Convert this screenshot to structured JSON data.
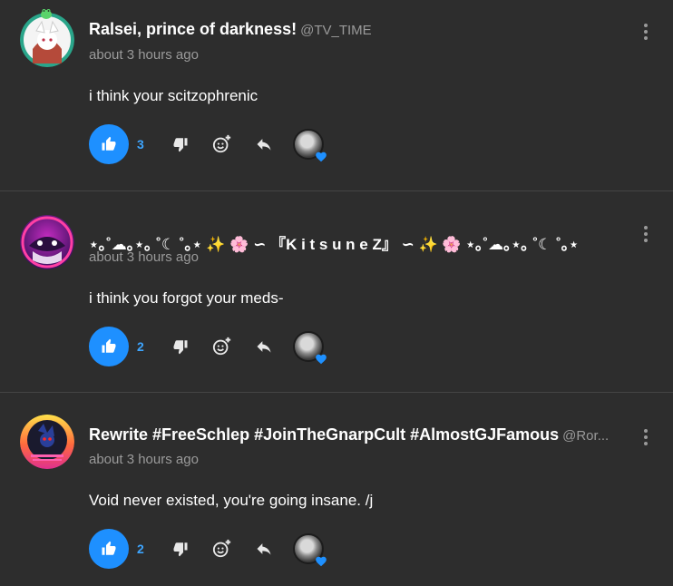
{
  "posts": [
    {
      "author": "Ralsei, prince of darkness!",
      "handle": "@TV_TIME",
      "time": "about 3 hours ago",
      "text": "i think your scitzophrenic",
      "likes": "3"
    },
    {
      "author": "⋆｡˚☁︎｡⋆｡ ˚☾ ˚｡⋆ ✨ 🌸 ∽ 『K i t s u n e Z』 ∽ ✨ 🌸 ⋆｡˚☁︎｡⋆｡ ˚☾ ˚｡⋆",
      "handle": "",
      "time": "about 3 hours ago",
      "text": "i think you forgot your meds-",
      "likes": "2"
    },
    {
      "author": "Rewrite #FreeSchlep #JoinTheGnarpCult #AlmostGJFamous",
      "handle": "@Ror...",
      "time": "about 3 hours ago",
      "text": "Void never existed, you're going insane. /j",
      "likes": "2"
    }
  ],
  "colors": {
    "background": "#2d2d2d",
    "accent": "#1e90ff",
    "muted": "#9a9a9a"
  },
  "icons": {
    "like": "thumbs-up-icon",
    "dislike": "thumbs-down-icon",
    "react": "add-reaction-icon",
    "reply": "reply-icon",
    "more": "more-vertical-icon",
    "heart": "heart-icon"
  }
}
